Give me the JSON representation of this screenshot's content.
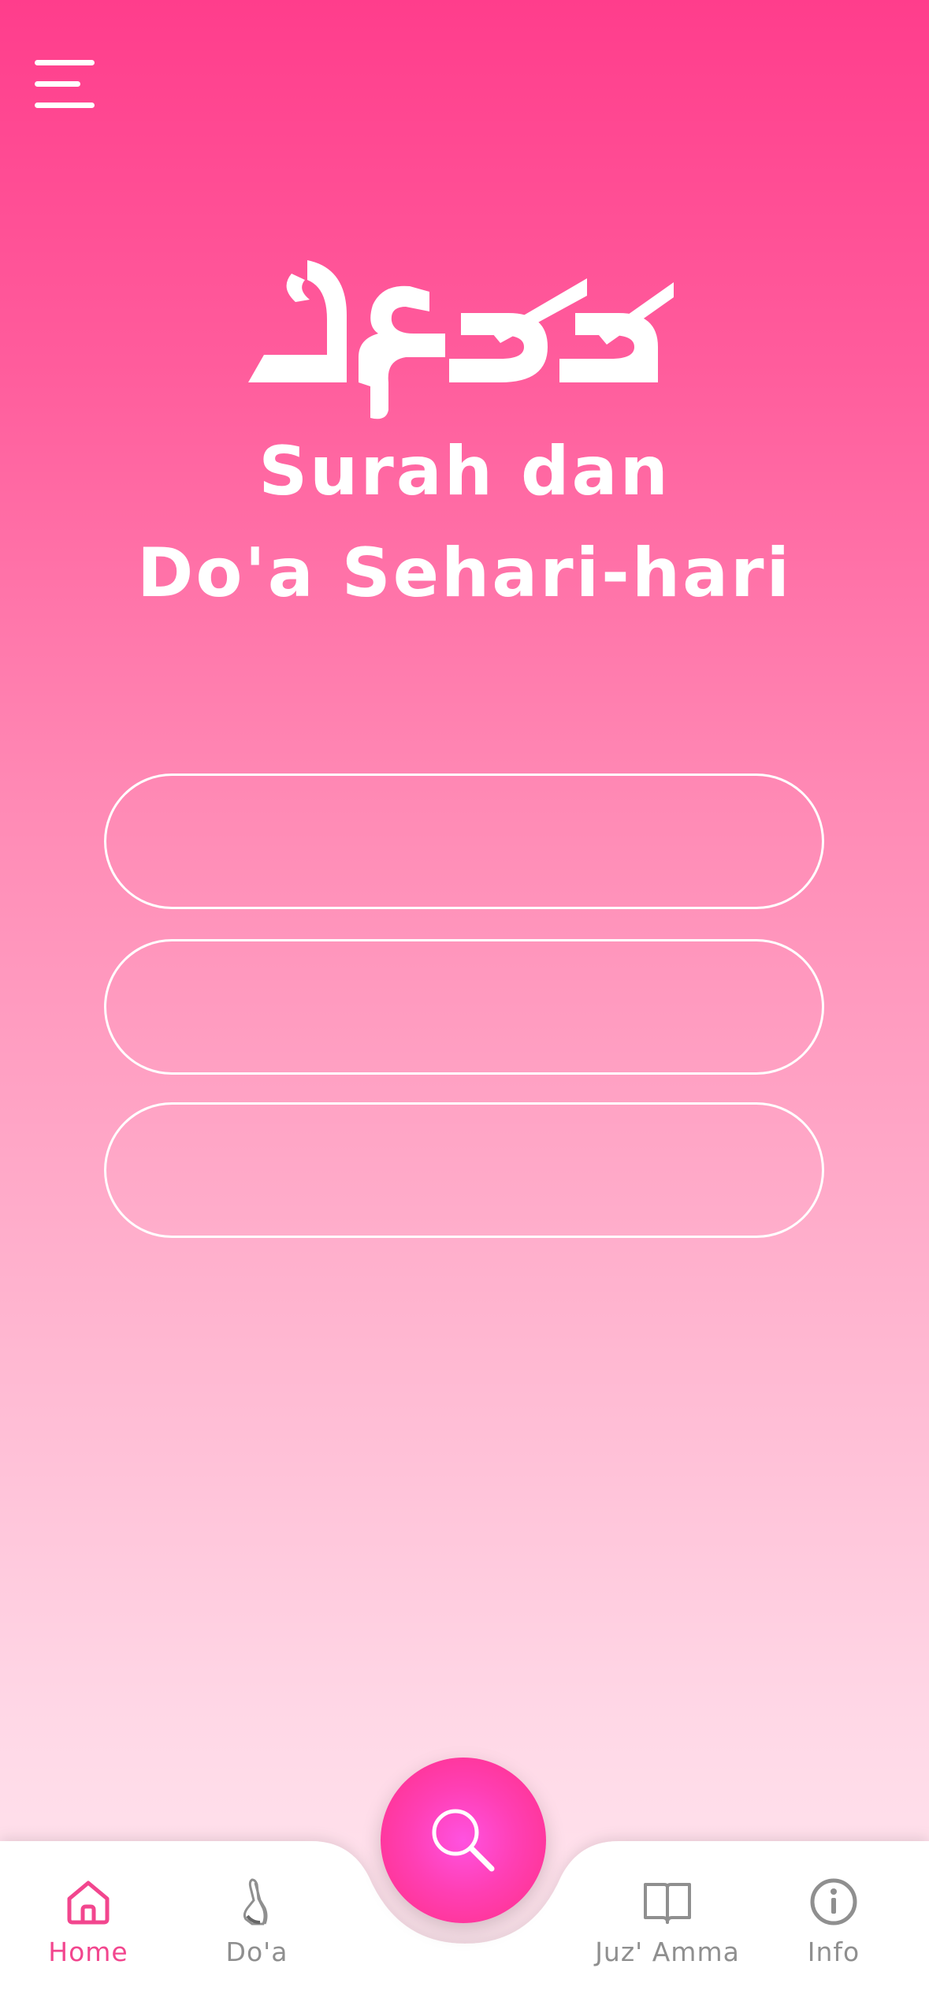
{
  "header": {
    "menu_icon": "hamburger-menu-icon",
    "title_line1": "Surah dan",
    "title_line2": "Do'a Sehari-hari",
    "logo": "arabic-calligraphy-logo"
  },
  "menu_buttons": [
    {
      "label": ""
    },
    {
      "label": ""
    },
    {
      "label": ""
    }
  ],
  "search_button": {
    "icon": "search-icon"
  },
  "bottom_nav": {
    "items": [
      {
        "label": "Home",
        "icon": "home-icon",
        "active": true
      },
      {
        "label": "Do'a",
        "icon": "praying-hands-icon",
        "active": false
      },
      {
        "label": "Juz' Amma",
        "icon": "book-icon",
        "active": false
      },
      {
        "label": "Info",
        "icon": "info-icon",
        "active": false
      }
    ]
  },
  "colors": {
    "gradient_top": "#ff3d8c",
    "gradient_bottom": "#ffeaf1",
    "accent": "#f2468e",
    "inactive": "#8f8f8f"
  }
}
